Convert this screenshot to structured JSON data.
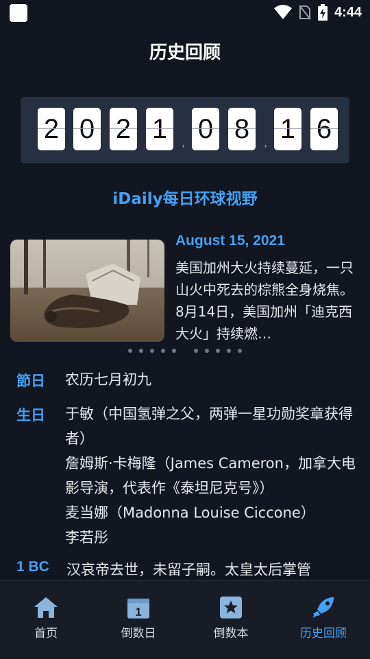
{
  "status_bar": {
    "time": "4:44"
  },
  "header": {
    "title": "历史回顾"
  },
  "date_display": {
    "year": [
      "2",
      "0",
      "2",
      "1"
    ],
    "month": [
      "0",
      "8"
    ],
    "day": [
      "1",
      "6"
    ],
    "separator": ","
  },
  "section": {
    "title": "iDaily每日环球视野"
  },
  "news": {
    "date": "August 15, 2021",
    "text": "美国加州大火持续蔓延，一只山火中死去的棕熊全身烧焦。8月14日，美国加州「迪克西大火」持续燃…",
    "image_icon": "news-photo-icon"
  },
  "holiday": {
    "label": "節日",
    "text": "农历七月初九"
  },
  "birthday": {
    "label": "生日",
    "entries": [
      "于敏（中国氢弹之父，两弹一星功勋奖章获得者）",
      "詹姆斯·卡梅隆（James Cameron，加拿大电影导演，代表作《泰坦尼克号》）",
      "麦当娜（Madonna Louise Ciccone）",
      "李若彤"
    ]
  },
  "event": {
    "label": "1 BC",
    "text": "汉哀帝去世，未留子嗣。太皇太后掌管"
  },
  "nav": [
    {
      "label": "首页",
      "icon": "home-icon"
    },
    {
      "label": "倒数日",
      "icon": "calendar-one-icon"
    },
    {
      "label": "倒数本",
      "icon": "star-book-icon"
    },
    {
      "label": "历史回顾",
      "icon": "rocket-icon"
    }
  ],
  "colors": {
    "accent": "#46a0f5",
    "background": "#111620",
    "panel": "#263040"
  }
}
